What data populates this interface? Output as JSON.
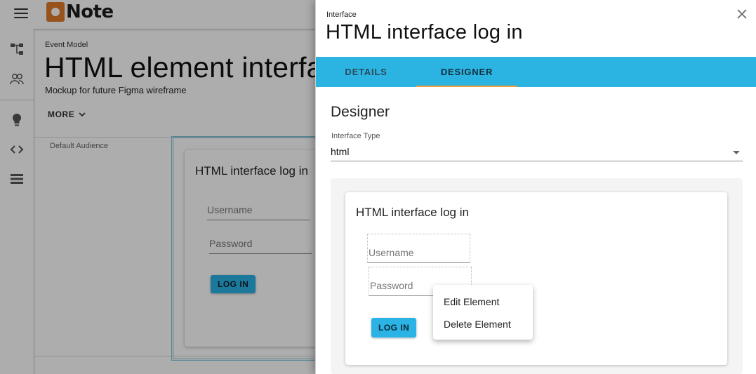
{
  "app": {
    "logo_text": "Note",
    "brand_color": "#e07b2a"
  },
  "sidebar": {
    "icons": [
      "hierarchy-icon",
      "people-icon",
      "lightbulb-icon",
      "code-icon",
      "list-icon"
    ]
  },
  "page": {
    "breadcrumb": "Event Model",
    "title": "HTML element interface",
    "subtitle": "Mockup for future Figma wireframe",
    "more_label": "MORE",
    "audience_label": "Default Audience"
  },
  "background_card": {
    "title": "HTML interface log in",
    "username_placeholder": "Username",
    "password_placeholder": "Password",
    "button_label": "LOG IN"
  },
  "drawer": {
    "kicker": "Interface",
    "title": "HTML interface log in",
    "tabs": [
      {
        "label": "DETAILS",
        "active": false
      },
      {
        "label": "DESIGNER",
        "active": true
      }
    ],
    "tab_bar_color": "#2bb3e1",
    "tab_indicator_color": "#f39c3c",
    "designer_heading": "Designer",
    "interface_type_label": "Interface Type",
    "interface_type_value": "html",
    "preview": {
      "title": "HTML interface log in",
      "username_placeholder": "Username",
      "password_placeholder": "Password",
      "button_label": "LOG IN"
    },
    "context_menu": {
      "items": [
        "Edit Element",
        "Delete Element"
      ]
    }
  }
}
